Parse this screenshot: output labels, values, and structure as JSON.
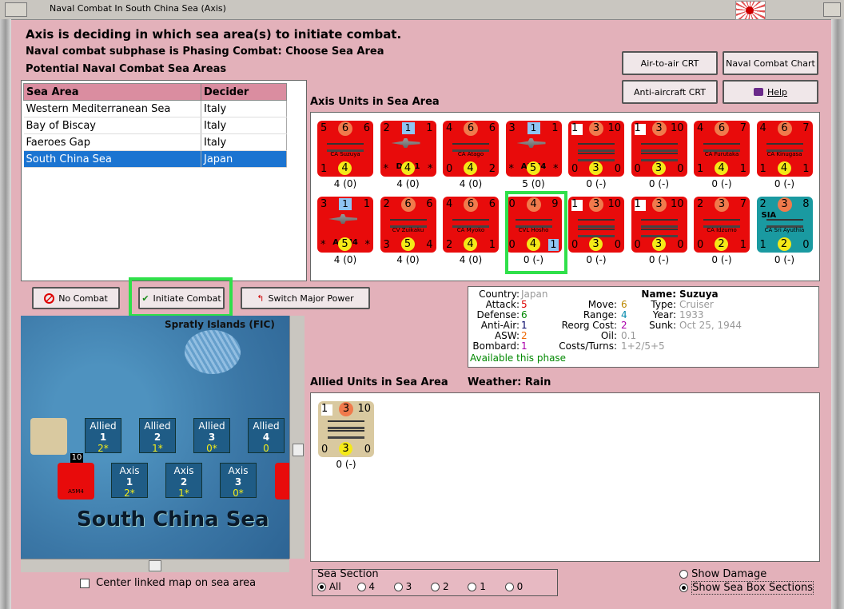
{
  "window": {
    "title": "Naval Combat In South China Sea (Axis)"
  },
  "headers": {
    "line1": "Axis is deciding in which sea area(s) to initiate combat.",
    "line2": "Naval combat subphase is Phasing Combat: Choose Sea Area",
    "line3": "Potential Naval Combat Sea Areas"
  },
  "buttons": {
    "air_to_air": "Air-to-air CRT",
    "naval_chart": "Naval Combat Chart",
    "anti_aircraft": "Anti-aircraft CRT",
    "help": "Help",
    "no_combat": "No Combat",
    "initiate": "Initiate Combat",
    "switch": "Switch Major Power"
  },
  "sea_table": {
    "headers": [
      "Sea Area",
      "Decider"
    ],
    "rows": [
      [
        "Western Mediterranean Sea",
        "Italy"
      ],
      [
        "Bay of Biscay",
        "Italy"
      ],
      [
        "Faeroes Gap",
        "Italy"
      ],
      [
        "South China Sea",
        "Japan"
      ]
    ]
  },
  "axis_units": {
    "label": "Axis Units in Sea Area",
    "row1": [
      {
        "tl": "5",
        "mid": "6",
        "tr": "6",
        "name": "CA Suzuya",
        "bl": "1",
        "bot": "4",
        "br": "",
        "cap": "4 (0)",
        "kind": "ship",
        "color": "red"
      },
      {
        "tl": "2",
        "mid": "1",
        "tr": "1",
        "name": "D3A1",
        "bl": "*",
        "bot": "4",
        "br": "*",
        "cap": "4 (0)",
        "kind": "plane",
        "color": "red",
        "midsq": true
      },
      {
        "tl": "4",
        "mid": "6",
        "tr": "6",
        "name": "CA Atago",
        "bl": "0",
        "bot": "4",
        "br": "2",
        "cap": "4 (0)",
        "kind": "ship",
        "color": "red"
      },
      {
        "tl": "3",
        "mid": "1",
        "tr": "1",
        "name": "A5M4",
        "bl": "*",
        "bot": "5",
        "br": "*",
        "cap": "5 (0)",
        "kind": "plane",
        "color": "red",
        "midsq": true
      },
      {
        "tl": "1",
        "mid": "3",
        "tr": "10",
        "name": "",
        "bl": "0",
        "bot": "3",
        "br": "0",
        "cap": "0 (-)",
        "kind": "ship",
        "color": "red",
        "w": true
      },
      {
        "tl": "1",
        "mid": "3",
        "tr": "10",
        "name": "",
        "bl": "0",
        "bot": "3",
        "br": "0",
        "cap": "0 (-)",
        "kind": "ship",
        "color": "red",
        "w": true
      },
      {
        "tl": "4",
        "mid": "6",
        "tr": "7",
        "name": "CA Furutaka",
        "bl": "1",
        "bot": "4",
        "br": "1",
        "cap": "0 (-)",
        "kind": "ship",
        "color": "red"
      },
      {
        "tl": "4",
        "mid": "6",
        "tr": "7",
        "name": "CA Kinugasa",
        "bl": "1",
        "bot": "4",
        "br": "1",
        "cap": "0 (-)",
        "kind": "ship",
        "color": "red"
      }
    ],
    "row2": [
      {
        "tl": "3",
        "mid": "1",
        "tr": "1",
        "name": "A5M4",
        "bl": "*",
        "bot": "5",
        "br": "*",
        "cap": "4 (0)",
        "kind": "plane",
        "color": "red",
        "midsq": true
      },
      {
        "tl": "2",
        "mid": "6",
        "tr": "6",
        "name": "CV Zuikaku",
        "bl": "3",
        "bot": "5",
        "br": "4",
        "cap": "4 (0)",
        "kind": "ship",
        "color": "red"
      },
      {
        "tl": "4",
        "mid": "6",
        "tr": "6",
        "name": "CA Myoko",
        "bl": "2",
        "bot": "4",
        "br": "1",
        "cap": "4 (0)",
        "kind": "ship",
        "color": "red"
      },
      {
        "tl": "0",
        "mid": "4",
        "tr": "9",
        "name": "CVL Hosho",
        "bl": "0",
        "bot": "4",
        "br": "1",
        "cap": "0 (-)",
        "kind": "ship",
        "color": "red"
      },
      {
        "tl": "1",
        "mid": "3",
        "tr": "10",
        "name": "",
        "bl": "0",
        "bot": "3",
        "br": "0",
        "cap": "0 (-)",
        "kind": "ship",
        "color": "red",
        "w": true
      },
      {
        "tl": "1",
        "mid": "3",
        "tr": "10",
        "name": "",
        "bl": "0",
        "bot": "3",
        "br": "0",
        "cap": "0 (-)",
        "kind": "ship",
        "color": "red",
        "w": true
      },
      {
        "tl": "2",
        "mid": "3",
        "tr": "7",
        "name": "CA Idzumo",
        "bl": "0",
        "bot": "2",
        "br": "1",
        "cap": "0 (-)",
        "kind": "ship",
        "color": "red"
      },
      {
        "tl": "2",
        "mid": "3",
        "tr": "8",
        "name": "CA Sri Ayuthia",
        "bl": "1",
        "bot": "2",
        "br": "0",
        "cap": "0 (-)",
        "kind": "ship",
        "color": "teal",
        "sia": "SIA"
      }
    ]
  },
  "info": {
    "country_l": "Country:",
    "country": "Japan",
    "attack_l": "Attack:",
    "attack": "5",
    "defense_l": "Defense:",
    "defense": "6",
    "aa_l": "Anti-Air:",
    "aa": "1",
    "asw_l": "ASW:",
    "asw": "2",
    "bombard_l": "Bombard:",
    "bombard": "1",
    "available": "Available this phase",
    "move_l": "Move:",
    "move": "6",
    "range_l": "Range:",
    "range": "4",
    "reorg_l": "Reorg Cost:",
    "reorg": "2",
    "oil_l": "Oil:",
    "oil": "0.1",
    "costs_l": "Costs/Turns:",
    "costs": "1+2/5+5",
    "name_l": "Name:",
    "name": "Suzuya",
    "type_l": "Type:",
    "type": "Cruiser",
    "year_l": "Year:",
    "year": "1933",
    "sunk_l": "Sunk:",
    "sunk": "Oct 25, 1944"
  },
  "allied": {
    "label": "Allied Units in Sea Area",
    "weather": "Weather:  Rain",
    "unit": {
      "tl": "1",
      "mid": "3",
      "tr": "10",
      "bl": "0",
      "bot": "3",
      "br": "0",
      "cap": "0 (-)"
    }
  },
  "map": {
    "title": "South China Sea",
    "island": "Spratly Islands (FIC)",
    "allied_boxes": [
      {
        "label": "Allied",
        "num": "1",
        "val": "2*"
      },
      {
        "label": "Allied",
        "num": "2",
        "val": "1*"
      },
      {
        "label": "Allied",
        "num": "3",
        "val": "0*"
      },
      {
        "label": "Allied",
        "num": "4",
        "val": "0"
      }
    ],
    "axis_boxes": [
      {
        "label": "Axis",
        "num": "1",
        "val": "2*"
      },
      {
        "label": "Axis",
        "num": "2",
        "val": "1*"
      },
      {
        "label": "Axis",
        "num": "3",
        "val": "0*"
      }
    ],
    "stack_count": "10",
    "plane_name": "A5M4"
  },
  "options": {
    "center_map": "Center linked map on sea area",
    "sea_section": "Sea Section",
    "sections": [
      "All",
      "4",
      "3",
      "2",
      "1",
      "0"
    ],
    "show_damage": "Show Damage",
    "show_boxes": "Show Sea Box Sections"
  },
  "colors": {
    "highlight": "#2fe04a",
    "selection": "#1b74d1",
    "counter_red": "#e80b0b"
  }
}
